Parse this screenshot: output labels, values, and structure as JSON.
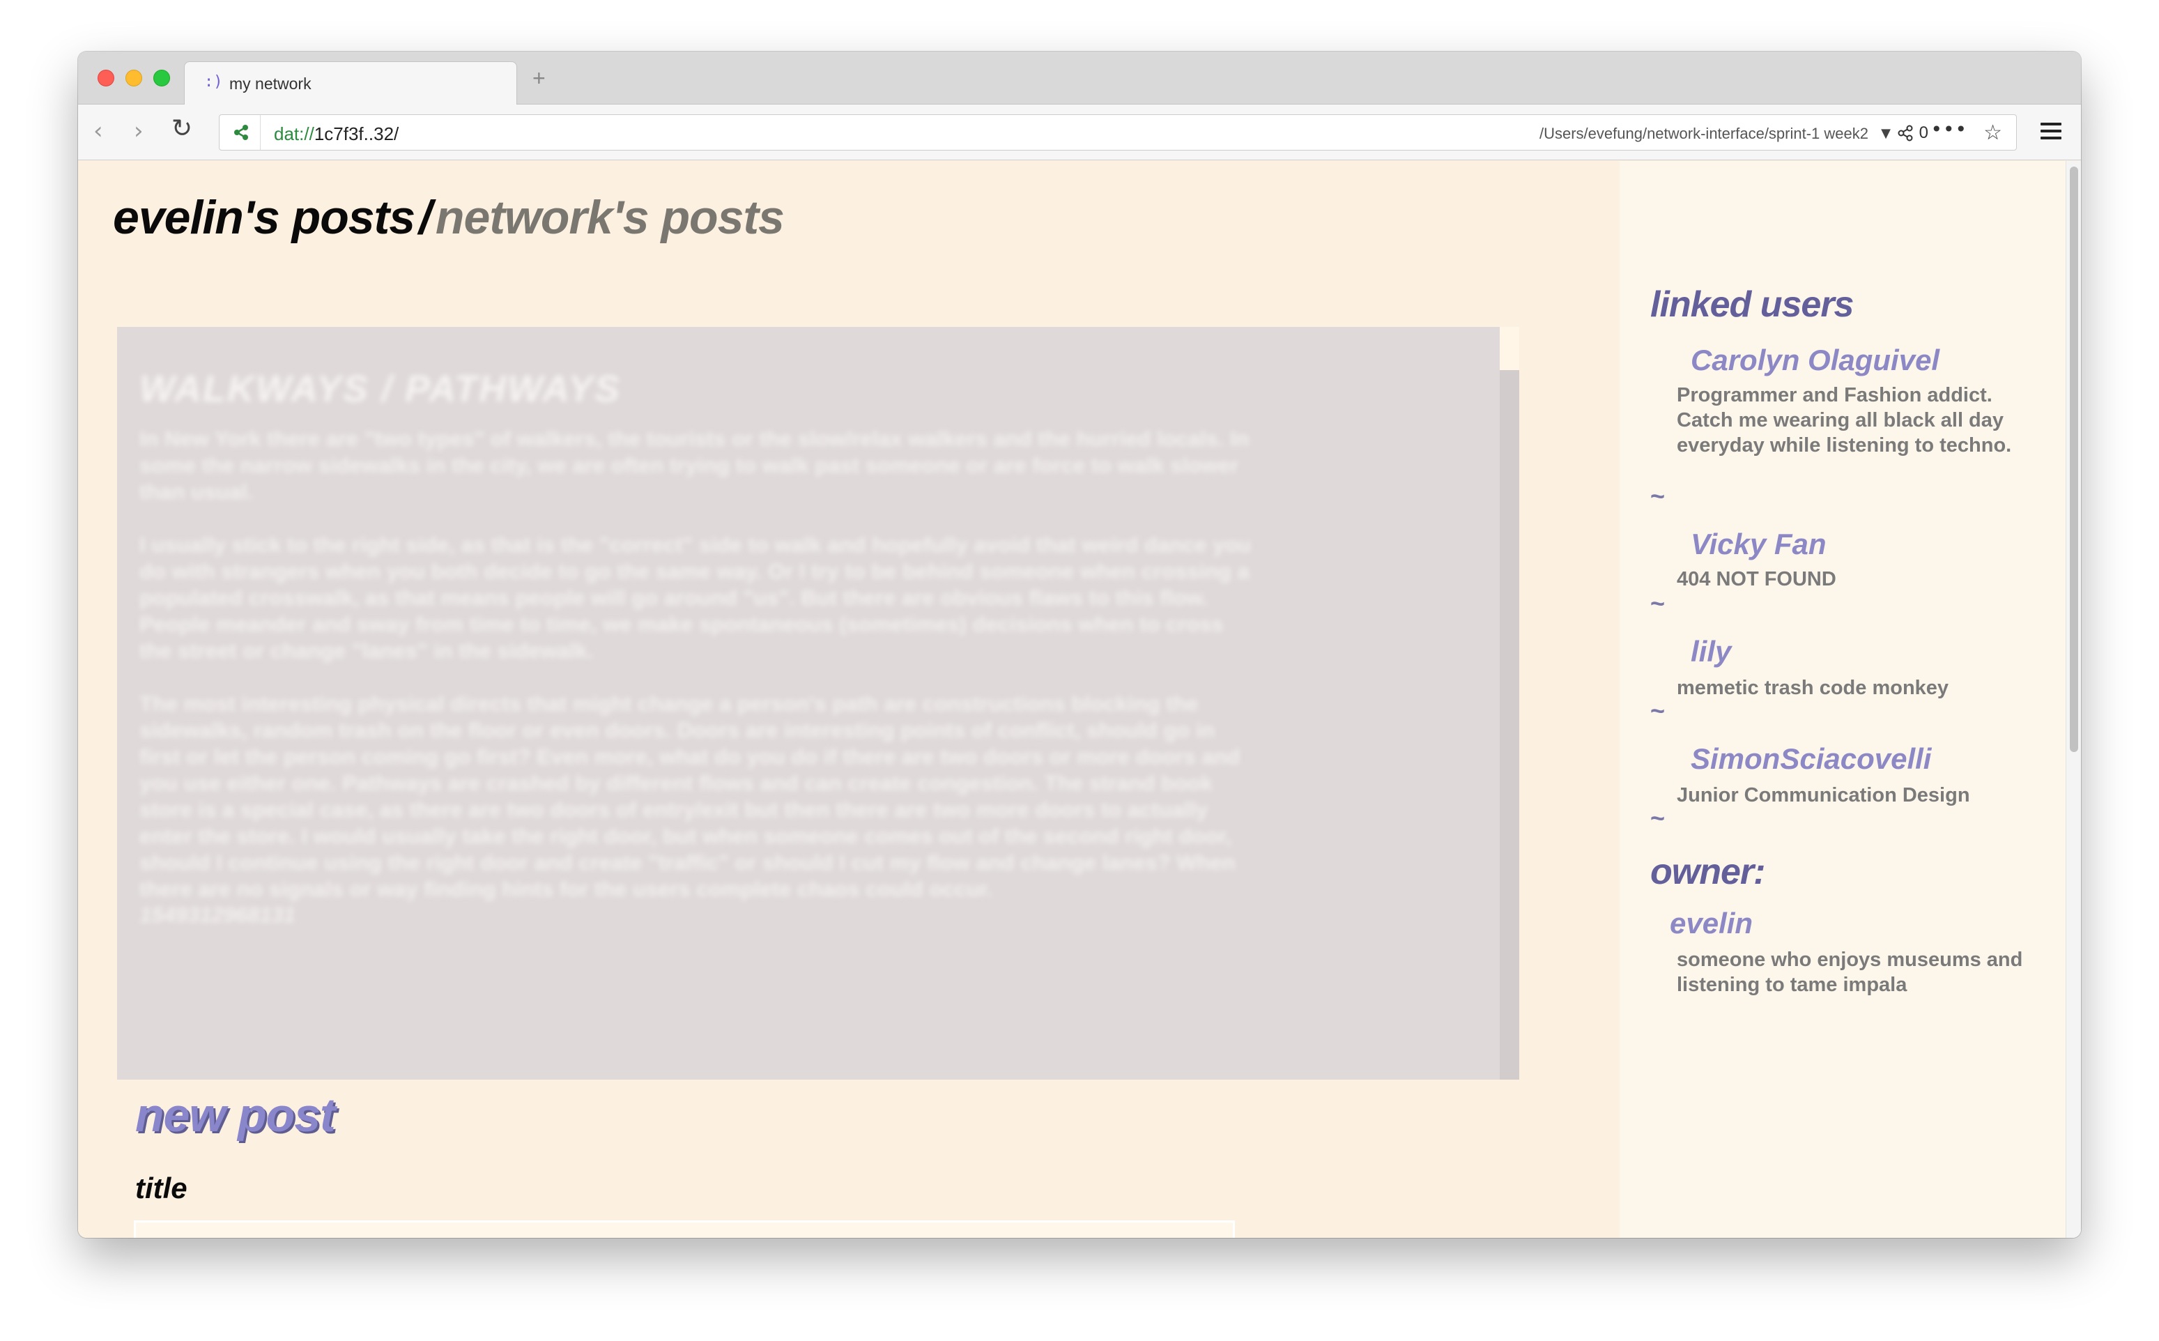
{
  "browser": {
    "tab_title": "my network",
    "tab_favicon": ":)",
    "new_tab_label": "+",
    "url_scheme": "dat://",
    "url_host": "1c7f3f..32/",
    "url_local_path": "/Users/evefung/network-interface/sprint-1 week2",
    "peer_count": "0",
    "icons": [
      "back-icon",
      "forward-icon",
      "reload-icon",
      "share-icon",
      "chevron-down-icon",
      "peers-icon",
      "more-icon",
      "star-icon",
      "menu-icon"
    ]
  },
  "page": {
    "heading_mine": "evelin's posts",
    "heading_sep": "/",
    "heading_network": "network's posts",
    "post": {
      "title": "WALKWAYS / PATHWAYS",
      "paragraphs": [
        "In New York there are \"two types\" of walkers, the tourists or the slow/relax walkers and the hurried locals. In some the narrow sidewalks in the city, we are often trying to walk past someone or are force to walk slower than usual.",
        "I usually stick to the right side, as that is the \"correct\" side to walk and hopefully avoid that weird dance you do with strangers when you both decide to go the same way. Or I try to be behind someone when crossing a populated crosswalk, as that means people will go around \"us\". But there are obvious flaws to this flow. People meander and sway from time to time, we make spontaneous (sometimes) decisions when to cross the street or change \"lanes\" in the sidewalk.",
        "The most interesting physical directs that might change a person's path are constructions blocking the sidewalks, random trash on the floor or even doors. Doors are interesting points of conflict, should go in first or let the person coming go first? Even more, what do you do if there are two doors or more doors and you use either one. Pathways are crashed by different flows and can create congestion. The strand book store is a special case, as there are two doors of entry/exit but then there are two more doors to actually enter the store. I would usually take the right door, but when someone comes out of the second right door, should I continue using the right door and create \"traffic\" or should I cut my flow and change lanes? When there are no signals or way finding hints for the users complete chaos could occur."
      ],
      "timestamp": "1549312968131"
    },
    "new_post_heading": "new post",
    "title_field_label": "title",
    "title_field_value": ""
  },
  "sidebar": {
    "linked_users_heading": "linked users",
    "users": [
      {
        "name": "Carolyn Olaguivel",
        "bio": "Programmer and Fashion addict. Catch me wearing all black all day everyday while listening to techno."
      },
      {
        "name": "Vicky Fan",
        "bio": "404 NOT FOUND"
      },
      {
        "name": "lily",
        "bio": "memetic trash code monkey"
      },
      {
        "name": "SimonSciacovelli",
        "bio": "Junior Communication Design"
      }
    ],
    "separator": "~",
    "owner_heading": "owner:",
    "owner": {
      "name": "evelin",
      "bio": "someone who enjoys museums and listening to tame impala"
    }
  }
}
